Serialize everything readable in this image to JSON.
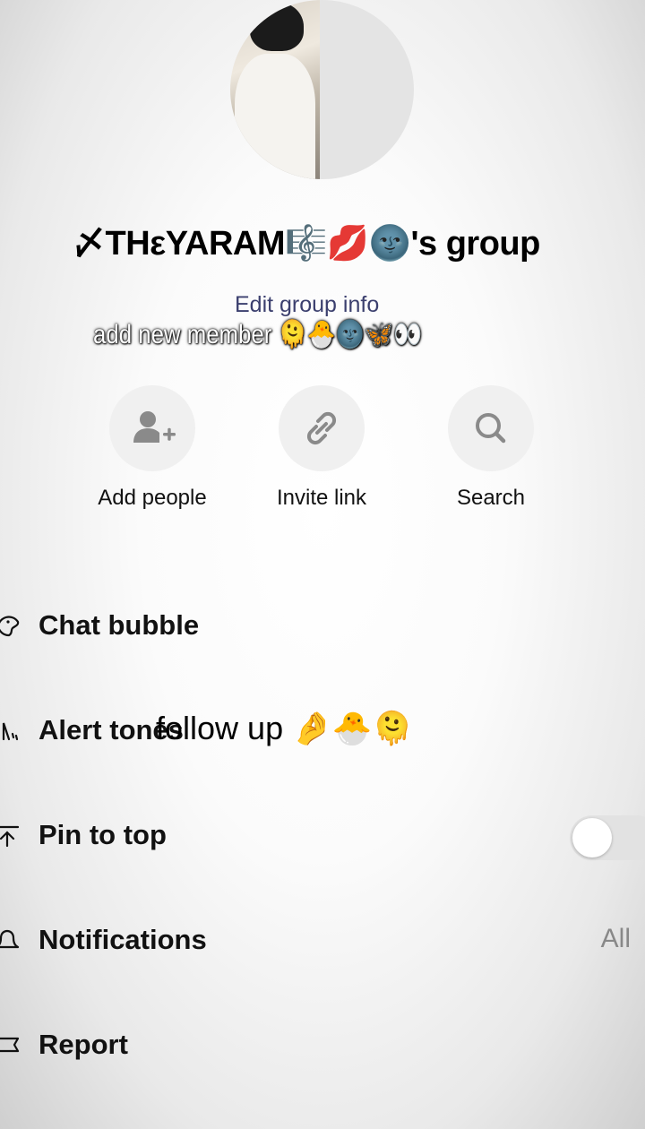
{
  "header": {
    "group_title": "〆THεYARAM🎼💋🌚's group",
    "edit_group_info": "Edit group info",
    "overlay_caption": "add new member 🫠🐣🌚🦋👀"
  },
  "actions": [
    {
      "label": "Add people",
      "icon": "add-person-icon"
    },
    {
      "label": "Invite link",
      "icon": "link-icon"
    },
    {
      "label": "Search",
      "icon": "search-icon"
    }
  ],
  "menu": {
    "chat_bubble": "Chat bubble",
    "alert_tones": "Alert tones",
    "pin_to_top": "Pin to top",
    "pin_to_top_enabled": false,
    "notifications": "Notifications",
    "notifications_value": "All",
    "report": "Report"
  },
  "follow_caption": "follow up 🤌🐣🫠",
  "colors": {
    "accent_link": "#3b3f6e",
    "toggle_off": "#e2e2e2",
    "icon_circle": "#f0f0f0"
  }
}
